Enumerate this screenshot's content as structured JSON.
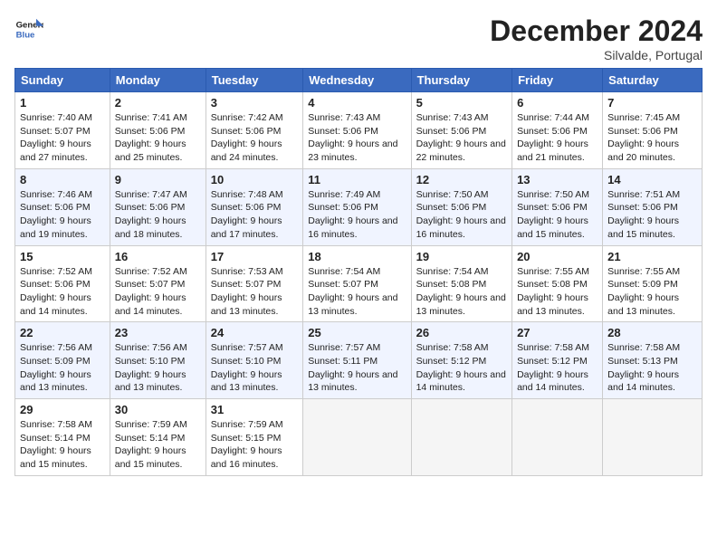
{
  "header": {
    "logo_line1": "General",
    "logo_line2": "Blue",
    "month": "December 2024",
    "location": "Silvalde, Portugal"
  },
  "days_of_week": [
    "Sunday",
    "Monday",
    "Tuesday",
    "Wednesday",
    "Thursday",
    "Friday",
    "Saturday"
  ],
  "weeks": [
    [
      {
        "num": "1",
        "sunrise": "Sunrise: 7:40 AM",
        "sunset": "Sunset: 5:07 PM",
        "daylight": "Daylight: 9 hours and 27 minutes."
      },
      {
        "num": "2",
        "sunrise": "Sunrise: 7:41 AM",
        "sunset": "Sunset: 5:06 PM",
        "daylight": "Daylight: 9 hours and 25 minutes."
      },
      {
        "num": "3",
        "sunrise": "Sunrise: 7:42 AM",
        "sunset": "Sunset: 5:06 PM",
        "daylight": "Daylight: 9 hours and 24 minutes."
      },
      {
        "num": "4",
        "sunrise": "Sunrise: 7:43 AM",
        "sunset": "Sunset: 5:06 PM",
        "daylight": "Daylight: 9 hours and 23 minutes."
      },
      {
        "num": "5",
        "sunrise": "Sunrise: 7:43 AM",
        "sunset": "Sunset: 5:06 PM",
        "daylight": "Daylight: 9 hours and 22 minutes."
      },
      {
        "num": "6",
        "sunrise": "Sunrise: 7:44 AM",
        "sunset": "Sunset: 5:06 PM",
        "daylight": "Daylight: 9 hours and 21 minutes."
      },
      {
        "num": "7",
        "sunrise": "Sunrise: 7:45 AM",
        "sunset": "Sunset: 5:06 PM",
        "daylight": "Daylight: 9 hours and 20 minutes."
      }
    ],
    [
      {
        "num": "8",
        "sunrise": "Sunrise: 7:46 AM",
        "sunset": "Sunset: 5:06 PM",
        "daylight": "Daylight: 9 hours and 19 minutes."
      },
      {
        "num": "9",
        "sunrise": "Sunrise: 7:47 AM",
        "sunset": "Sunset: 5:06 PM",
        "daylight": "Daylight: 9 hours and 18 minutes."
      },
      {
        "num": "10",
        "sunrise": "Sunrise: 7:48 AM",
        "sunset": "Sunset: 5:06 PM",
        "daylight": "Daylight: 9 hours and 17 minutes."
      },
      {
        "num": "11",
        "sunrise": "Sunrise: 7:49 AM",
        "sunset": "Sunset: 5:06 PM",
        "daylight": "Daylight: 9 hours and 16 minutes."
      },
      {
        "num": "12",
        "sunrise": "Sunrise: 7:50 AM",
        "sunset": "Sunset: 5:06 PM",
        "daylight": "Daylight: 9 hours and 16 minutes."
      },
      {
        "num": "13",
        "sunrise": "Sunrise: 7:50 AM",
        "sunset": "Sunset: 5:06 PM",
        "daylight": "Daylight: 9 hours and 15 minutes."
      },
      {
        "num": "14",
        "sunrise": "Sunrise: 7:51 AM",
        "sunset": "Sunset: 5:06 PM",
        "daylight": "Daylight: 9 hours and 15 minutes."
      }
    ],
    [
      {
        "num": "15",
        "sunrise": "Sunrise: 7:52 AM",
        "sunset": "Sunset: 5:06 PM",
        "daylight": "Daylight: 9 hours and 14 minutes."
      },
      {
        "num": "16",
        "sunrise": "Sunrise: 7:52 AM",
        "sunset": "Sunset: 5:07 PM",
        "daylight": "Daylight: 9 hours and 14 minutes."
      },
      {
        "num": "17",
        "sunrise": "Sunrise: 7:53 AM",
        "sunset": "Sunset: 5:07 PM",
        "daylight": "Daylight: 9 hours and 13 minutes."
      },
      {
        "num": "18",
        "sunrise": "Sunrise: 7:54 AM",
        "sunset": "Sunset: 5:07 PM",
        "daylight": "Daylight: 9 hours and 13 minutes."
      },
      {
        "num": "19",
        "sunrise": "Sunrise: 7:54 AM",
        "sunset": "Sunset: 5:08 PM",
        "daylight": "Daylight: 9 hours and 13 minutes."
      },
      {
        "num": "20",
        "sunrise": "Sunrise: 7:55 AM",
        "sunset": "Sunset: 5:08 PM",
        "daylight": "Daylight: 9 hours and 13 minutes."
      },
      {
        "num": "21",
        "sunrise": "Sunrise: 7:55 AM",
        "sunset": "Sunset: 5:09 PM",
        "daylight": "Daylight: 9 hours and 13 minutes."
      }
    ],
    [
      {
        "num": "22",
        "sunrise": "Sunrise: 7:56 AM",
        "sunset": "Sunset: 5:09 PM",
        "daylight": "Daylight: 9 hours and 13 minutes."
      },
      {
        "num": "23",
        "sunrise": "Sunrise: 7:56 AM",
        "sunset": "Sunset: 5:10 PM",
        "daylight": "Daylight: 9 hours and 13 minutes."
      },
      {
        "num": "24",
        "sunrise": "Sunrise: 7:57 AM",
        "sunset": "Sunset: 5:10 PM",
        "daylight": "Daylight: 9 hours and 13 minutes."
      },
      {
        "num": "25",
        "sunrise": "Sunrise: 7:57 AM",
        "sunset": "Sunset: 5:11 PM",
        "daylight": "Daylight: 9 hours and 13 minutes."
      },
      {
        "num": "26",
        "sunrise": "Sunrise: 7:58 AM",
        "sunset": "Sunset: 5:12 PM",
        "daylight": "Daylight: 9 hours and 14 minutes."
      },
      {
        "num": "27",
        "sunrise": "Sunrise: 7:58 AM",
        "sunset": "Sunset: 5:12 PM",
        "daylight": "Daylight: 9 hours and 14 minutes."
      },
      {
        "num": "28",
        "sunrise": "Sunrise: 7:58 AM",
        "sunset": "Sunset: 5:13 PM",
        "daylight": "Daylight: 9 hours and 14 minutes."
      }
    ],
    [
      {
        "num": "29",
        "sunrise": "Sunrise: 7:58 AM",
        "sunset": "Sunset: 5:14 PM",
        "daylight": "Daylight: 9 hours and 15 minutes."
      },
      {
        "num": "30",
        "sunrise": "Sunrise: 7:59 AM",
        "sunset": "Sunset: 5:14 PM",
        "daylight": "Daylight: 9 hours and 15 minutes."
      },
      {
        "num": "31",
        "sunrise": "Sunrise: 7:59 AM",
        "sunset": "Sunset: 5:15 PM",
        "daylight": "Daylight: 9 hours and 16 minutes."
      },
      null,
      null,
      null,
      null
    ]
  ]
}
